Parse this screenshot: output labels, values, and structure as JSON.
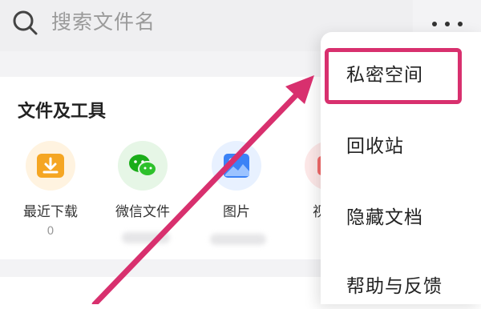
{
  "search": {
    "placeholder": "搜索文件名"
  },
  "more_icon": "more-dots-icon",
  "section": {
    "title": "文件及工具"
  },
  "tools": [
    {
      "label": "最近下载",
      "count": "0",
      "icon": "download-icon",
      "color": "#f5a623"
    },
    {
      "label": "微信文件",
      "count": "",
      "icon": "wechat-icon",
      "color": "#1aad19"
    },
    {
      "label": "图片",
      "count": "",
      "icon": "image-icon",
      "color": "#3b82f6"
    },
    {
      "label": "视",
      "count": "",
      "icon": "video-icon",
      "color": "#f36b6b"
    }
  ],
  "menu": {
    "items": [
      {
        "label": "私密空间",
        "highlighted": true
      },
      {
        "label": "回收站"
      },
      {
        "label": "隐藏文档"
      },
      {
        "label": "帮助与反馈"
      }
    ]
  },
  "annotation": {
    "color": "#d8306e"
  }
}
